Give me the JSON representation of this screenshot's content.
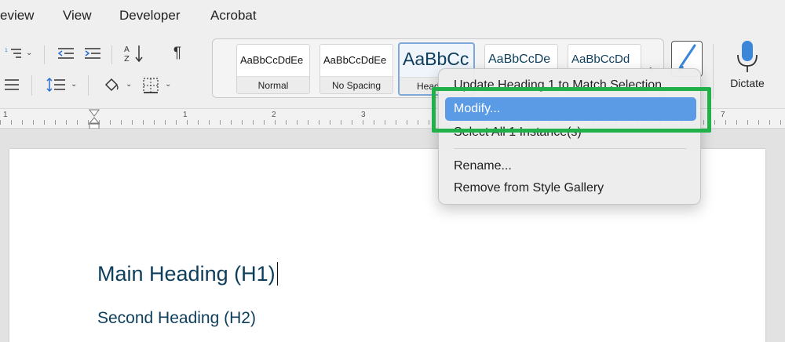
{
  "menubar": {
    "items": [
      "eview",
      "View",
      "Developer",
      "Acrobat"
    ]
  },
  "ribbon": {
    "styles": [
      {
        "sample": "AaBbCcDdEe",
        "name": "Normal"
      },
      {
        "sample": "AaBbCcDdEe",
        "name": "No Spacing"
      },
      {
        "sample": "AaBbCc",
        "name": "Head"
      },
      {
        "sample": "AaBbCcDe",
        "name": ""
      },
      {
        "sample": "AaBbCcDd",
        "name": ""
      }
    ],
    "dictate_label": "Dictate",
    "accent": "#5b9be6",
    "callout_color": "#22b04b",
    "heading_color": "#0d3e5c"
  },
  "ruler": {
    "numbers": [
      "1",
      "1",
      "2",
      "3",
      "7"
    ]
  },
  "document": {
    "heading1": "Main Heading (H1)",
    "heading2": "Second Heading (H2)"
  },
  "context_menu": {
    "items": [
      "Update Heading 1 to Match Selection",
      "Modify...",
      "Select All 1 Instance(s)",
      "Rename...",
      "Remove from Style Gallery"
    ]
  }
}
